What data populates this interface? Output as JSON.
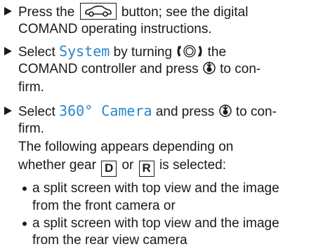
{
  "steps": [
    {
      "lines": [
        {
          "before": "Press the",
          "after": "button; see the digital"
        },
        {
          "text": "COMAND operating instructions."
        }
      ],
      "icon": "car-button-icon"
    },
    {
      "lines": [
        {
          "before": "Select",
          "highlight": "System",
          "after": "by turning"
        },
        {
          "before": "COMAND controller and press",
          "after": "to con-"
        },
        {
          "text": "firm."
        }
      ],
      "icons": [
        "rotate-controller-icon",
        "press-controller-icon"
      ]
    },
    {
      "lines": [
        {
          "before": "Select",
          "highlight": "360° Camera",
          "after": "and press",
          "after2": "to con-"
        },
        {
          "text": "firm."
        },
        {
          "text": "The following appears depending on"
        },
        {
          "before": "whether gear",
          "gear1": "D",
          "mid": "or",
          "gear2": "R",
          "after": "is selected:"
        }
      ]
    }
  ],
  "sub_bullets": [
    {
      "line1": "a split screen with top view and the image",
      "line2": "from the front camera or"
    },
    {
      "line1": "a split screen with top view and the image",
      "line2": "from the rear view camera"
    }
  ],
  "colors": {
    "text": "#1a1a1a",
    "highlight": "#2a86c9"
  }
}
